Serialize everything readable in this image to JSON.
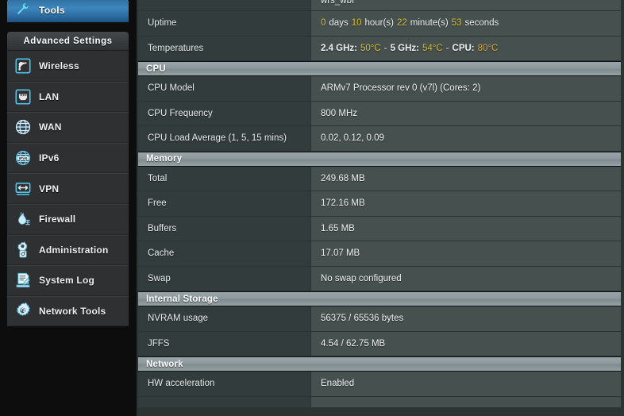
{
  "sidebar": {
    "tools_tab": {
      "label": "Tools",
      "icon": "wrench-icon"
    },
    "advanced_settings_header": "Advanced Settings",
    "items": [
      {
        "label": "Wireless",
        "icon": "wireless-signal-icon"
      },
      {
        "label": "LAN",
        "icon": "ethernet-port-icon"
      },
      {
        "label": "WAN",
        "icon": "globe-icon"
      },
      {
        "label": "IPv6",
        "icon": "ipv6-globe-icon"
      },
      {
        "label": "VPN",
        "icon": "vpn-monitor-icon"
      },
      {
        "label": "Firewall",
        "icon": "firewall-flame-icon"
      },
      {
        "label": "Administration",
        "icon": "gear-person-icon"
      },
      {
        "label": "System Log",
        "icon": "log-notepad-icon"
      },
      {
        "label": "Network Tools",
        "icon": "gear-tools-icon"
      }
    ]
  },
  "main": {
    "top_partial_row": {
      "label": "",
      "value": "wrs_wbf"
    },
    "sections": [
      {
        "title": "",
        "rows": [
          {
            "label": "Uptime",
            "segments": [
              {
                "text": "0",
                "accent": true
              },
              {
                "text": "days",
                "accent": false
              },
              {
                "text": "10",
                "accent": true
              },
              {
                "text": "hour(s)",
                "accent": false
              },
              {
                "text": "22",
                "accent": true
              },
              {
                "text": "minute(s)",
                "accent": false
              },
              {
                "text": "53",
                "accent": true
              },
              {
                "text": "seconds",
                "accent": false
              }
            ]
          },
          {
            "label": "Temperatures",
            "segments": [
              {
                "text": "2.4 GHz:",
                "accent": false,
                "bold": true
              },
              {
                "text": "50°C",
                "accent": true
              },
              {
                "text": "-",
                "accent": false
              },
              {
                "text": "5 GHz:",
                "accent": false,
                "bold": true
              },
              {
                "text": "54°C",
                "accent": true
              },
              {
                "text": "-",
                "accent": false
              },
              {
                "text": "CPU:",
                "accent": false,
                "bold": true
              },
              {
                "text": "80°C",
                "accent": true,
                "warm": true
              }
            ]
          }
        ]
      },
      {
        "title": "CPU",
        "rows": [
          {
            "label": "CPU Model",
            "value": "ARMv7 Processor rev 0 (v7l)   (Cores: 2)"
          },
          {
            "label": "CPU Frequency",
            "value": "800 MHz"
          },
          {
            "label": "CPU Load Average (1, 5, 15 mins)",
            "value": "0.02, 0.12, 0.09"
          }
        ]
      },
      {
        "title": "Memory",
        "rows": [
          {
            "label": "Total",
            "value": "249.68 MB"
          },
          {
            "label": "Free",
            "value": "172.16 MB"
          },
          {
            "label": "Buffers",
            "value": "1.65 MB"
          },
          {
            "label": "Cache",
            "value": "17.07 MB"
          },
          {
            "label": "Swap",
            "value": "No swap configured",
            "accent": true
          }
        ]
      },
      {
        "title": "Internal Storage",
        "rows": [
          {
            "label": "NVRAM usage",
            "value": "56375 / 65536 bytes"
          },
          {
            "label": "JFFS",
            "value": "4.54 / 62.75 MB"
          }
        ]
      },
      {
        "title": "Network",
        "rows": [
          {
            "label": "HW acceleration",
            "value": "Enabled",
            "accent": true
          }
        ]
      }
    ]
  },
  "colors": {
    "accent_yellow": "#d8c037",
    "accent_orange": "#d9a53a",
    "icon_cyan": "#4fc3e8",
    "tab_blue": "#3d87bd",
    "panel_bg": "#2e3032",
    "value_bg": "#46514f",
    "label_bg": "#323c3c"
  }
}
